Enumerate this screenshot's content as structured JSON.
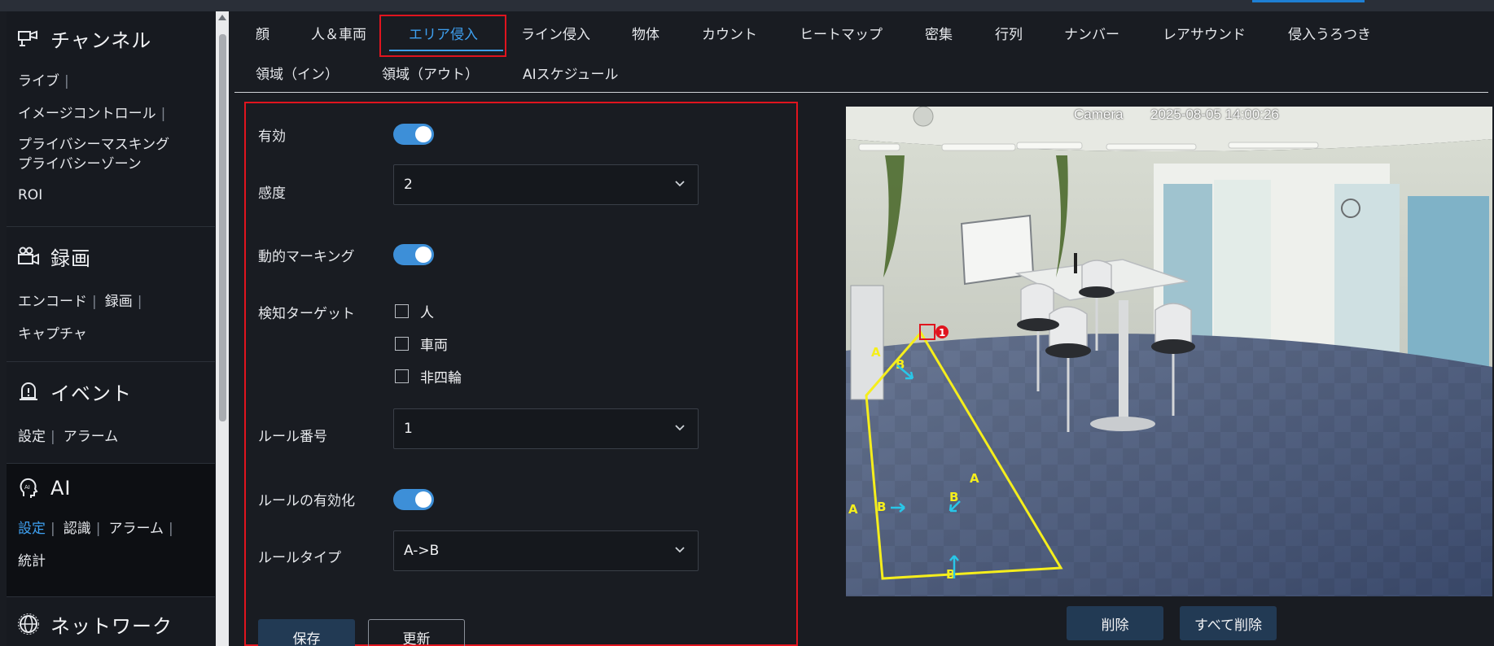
{
  "sidebar": {
    "channel": {
      "title": "チャンネル",
      "items": [
        "ライブ",
        "イメージコントロール",
        "プライバシーマスキング",
        "プライバシーゾーン",
        "ROI"
      ]
    },
    "record": {
      "title": "録画",
      "items": [
        "エンコード",
        "録画",
        "キャプチャ"
      ]
    },
    "event": {
      "title": "イベント",
      "items": [
        "設定",
        "アラーム"
      ]
    },
    "ai": {
      "title": "AI",
      "items": [
        "設定",
        "認識",
        "アラーム",
        "統計"
      ]
    },
    "network": {
      "title": "ネットワーク"
    }
  },
  "tabs": {
    "row1": [
      "顔",
      "人＆車両",
      "エリア侵入",
      "ライン侵入",
      "物体",
      "カウント",
      "ヒートマップ",
      "密集",
      "行列",
      "ナンバー",
      "レアサウンド",
      "侵入うろつき"
    ],
    "row2": [
      "領域（イン）",
      "領域（アウト）",
      "AIスケジュール"
    ],
    "active": "エリア侵入"
  },
  "form": {
    "enable_label": "有効",
    "enable_on": true,
    "sensitivity_label": "感度",
    "sensitivity_value": "2",
    "dynamic_marking_label": "動的マーキング",
    "dynamic_marking_on": true,
    "target_label": "検知ターゲット",
    "targets": [
      "人",
      "車両",
      "非四輪"
    ],
    "rule_number_label": "ルール番号",
    "rule_number_value": "1",
    "rule_enable_label": "ルールの有効化",
    "rule_enable_on": true,
    "rule_type_label": "ルールタイプ",
    "rule_type_value": "A->B",
    "save_label": "保存",
    "refresh_label": "更新"
  },
  "preview": {
    "osd_name": "Camera",
    "osd_time": "2025-08-05 14:00:26",
    "region_number": "1",
    "side_a": "A",
    "side_b": "B",
    "delete_label": "削除",
    "delete_all_label": "すべて削除"
  },
  "colors": {
    "accent": "#3ea0f0",
    "toggle_on": "#3d8fd8",
    "highlight_box": "#e0141e",
    "region_line": "#f5ee1c",
    "direction_arrow": "#29c6e8"
  }
}
